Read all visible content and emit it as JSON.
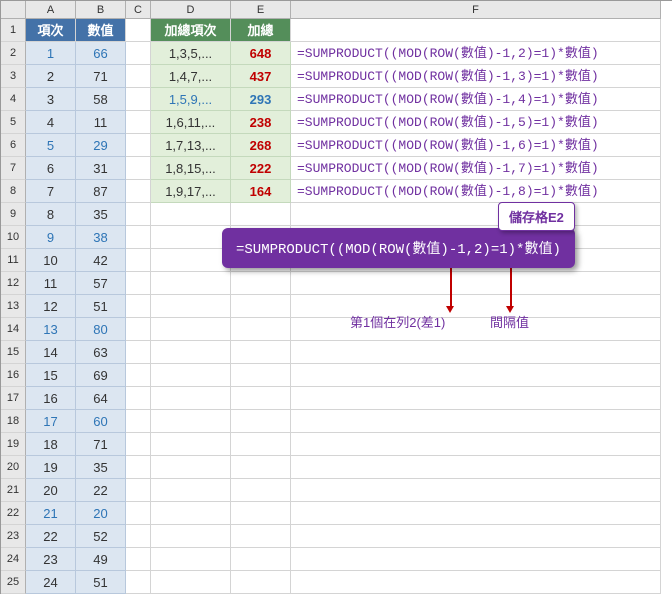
{
  "col_headers": [
    "A",
    "B",
    "C",
    "D",
    "E",
    "F"
  ],
  "row_headers": [
    "1",
    "2",
    "3",
    "4",
    "5",
    "6",
    "7",
    "8",
    "9",
    "10",
    "11",
    "12",
    "13",
    "14",
    "15",
    "16",
    "17",
    "18",
    "19",
    "20",
    "21",
    "22",
    "23",
    "24",
    "25"
  ],
  "ab_header": {
    "a": "項次",
    "b": "數值"
  },
  "de_header": {
    "d": "加總項次",
    "e": "加總"
  },
  "ab_rows": [
    {
      "a": "1",
      "b": "66",
      "acc": true
    },
    {
      "a": "2",
      "b": "71"
    },
    {
      "a": "3",
      "b": "58"
    },
    {
      "a": "4",
      "b": "11"
    },
    {
      "a": "5",
      "b": "29",
      "acc": true
    },
    {
      "a": "6",
      "b": "31"
    },
    {
      "a": "7",
      "b": "87"
    },
    {
      "a": "8",
      "b": "35"
    },
    {
      "a": "9",
      "b": "38",
      "acc": true
    },
    {
      "a": "10",
      "b": "42"
    },
    {
      "a": "11",
      "b": "57"
    },
    {
      "a": "12",
      "b": "51"
    },
    {
      "a": "13",
      "b": "80",
      "acc": true
    },
    {
      "a": "14",
      "b": "63"
    },
    {
      "a": "15",
      "b": "69"
    },
    {
      "a": "16",
      "b": "64"
    },
    {
      "a": "17",
      "b": "60",
      "acc": true
    },
    {
      "a": "18",
      "b": "71"
    },
    {
      "a": "19",
      "b": "35"
    },
    {
      "a": "20",
      "b": "22"
    },
    {
      "a": "21",
      "b": "20",
      "acc": true
    },
    {
      "a": "22",
      "b": "52"
    },
    {
      "a": "23",
      "b": "49"
    },
    {
      "a": "24",
      "b": "51"
    }
  ],
  "de_rows": [
    {
      "d": "1,3,5,...",
      "e": "648",
      "f": "=SUMPRODUCT((MOD(ROW(數值)-1,2)=1)*數值)"
    },
    {
      "d": "1,4,7,...",
      "e": "437",
      "f": "=SUMPRODUCT((MOD(ROW(數值)-1,3)=1)*數值)"
    },
    {
      "d": "1,5,9,...",
      "e": "293",
      "f": "=SUMPRODUCT((MOD(ROW(數值)-1,4)=1)*數值)",
      "acc": true
    },
    {
      "d": "1,6,11,...",
      "e": "238",
      "f": "=SUMPRODUCT((MOD(ROW(數值)-1,5)=1)*數值)"
    },
    {
      "d": "1,7,13,...",
      "e": "268",
      "f": "=SUMPRODUCT((MOD(ROW(數值)-1,6)=1)*數值)"
    },
    {
      "d": "1,8,15,...",
      "e": "222",
      "f": "=SUMPRODUCT((MOD(ROW(數值)-1,7)=1)*數值)"
    },
    {
      "d": "1,9,17,...",
      "e": "164",
      "f": "=SUMPRODUCT((MOD(ROW(數值)-1,8)=1)*數值)"
    }
  ],
  "callout": {
    "title": "儲存格E2",
    "formula": "=SUMPRODUCT((MOD(ROW(數值)-1,2)=1)*數值)",
    "label1": "第1個在列2(差1)",
    "label2": "間隔值"
  }
}
